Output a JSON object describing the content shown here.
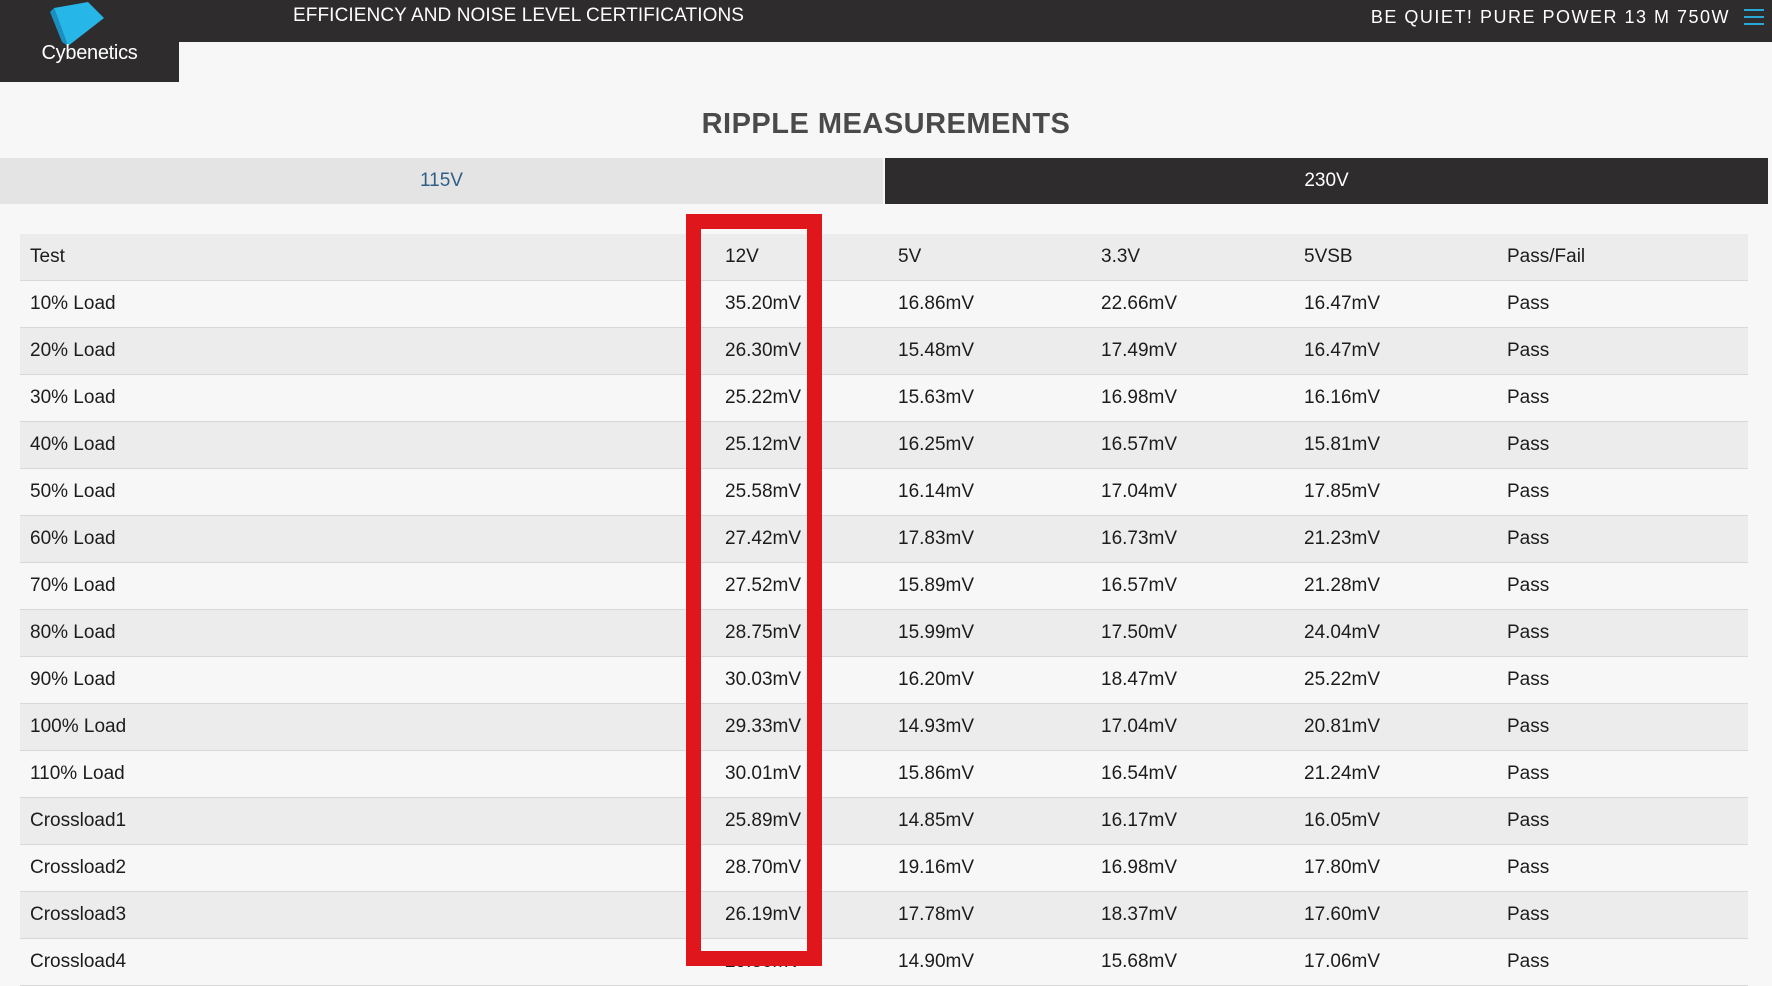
{
  "header": {
    "logo_text": "Cybenetics",
    "site_title": "EFFICIENCY AND NOISE LEVEL CERTIFICATIONS",
    "product_name": "BE QUIET! PURE POWER 13 M 750W",
    "accent_color": "#27a8d6",
    "menu_icon": "hamburger-menu-icon"
  },
  "section": {
    "title": "RIPPLE MEASUREMENTS"
  },
  "tabs": [
    {
      "label": "115V",
      "active": false
    },
    {
      "label": "230V",
      "active": true
    }
  ],
  "table": {
    "headers": [
      "Test",
      "12V",
      "5V",
      "3.3V",
      "5VSB",
      "Pass/Fail"
    ],
    "rows": [
      [
        "10% Load",
        "35.20mV",
        "16.86mV",
        "22.66mV",
        "16.47mV",
        "Pass"
      ],
      [
        "20% Load",
        "26.30mV",
        "15.48mV",
        "17.49mV",
        "16.47mV",
        "Pass"
      ],
      [
        "30% Load",
        "25.22mV",
        "15.63mV",
        "16.98mV",
        "16.16mV",
        "Pass"
      ],
      [
        "40% Load",
        "25.12mV",
        "16.25mV",
        "16.57mV",
        "15.81mV",
        "Pass"
      ],
      [
        "50% Load",
        "25.58mV",
        "16.14mV",
        "17.04mV",
        "17.85mV",
        "Pass"
      ],
      [
        "60% Load",
        "27.42mV",
        "17.83mV",
        "16.73mV",
        "21.23mV",
        "Pass"
      ],
      [
        "70% Load",
        "27.52mV",
        "15.89mV",
        "16.57mV",
        "21.28mV",
        "Pass"
      ],
      [
        "80% Load",
        "28.75mV",
        "15.99mV",
        "17.50mV",
        "24.04mV",
        "Pass"
      ],
      [
        "90% Load",
        "30.03mV",
        "16.20mV",
        "18.47mV",
        "25.22mV",
        "Pass"
      ],
      [
        "100% Load",
        "29.33mV",
        "14.93mV",
        "17.04mV",
        "20.81mV",
        "Pass"
      ],
      [
        "110% Load",
        "30.01mV",
        "15.86mV",
        "16.54mV",
        "21.24mV",
        "Pass"
      ],
      [
        "Crossload1",
        "25.89mV",
        "14.85mV",
        "16.17mV",
        "16.05mV",
        "Pass"
      ],
      [
        "Crossload2",
        "28.70mV",
        "19.16mV",
        "16.98mV",
        "17.80mV",
        "Pass"
      ],
      [
        "Crossload3",
        "26.19mV",
        "17.78mV",
        "18.37mV",
        "17.60mV",
        "Pass"
      ],
      [
        "Crossload4",
        "29.30mV",
        "14.90mV",
        "15.68mV",
        "17.06mV",
        "Pass"
      ]
    ]
  },
  "highlight": {
    "column": "12V",
    "color": "#e0161d"
  }
}
